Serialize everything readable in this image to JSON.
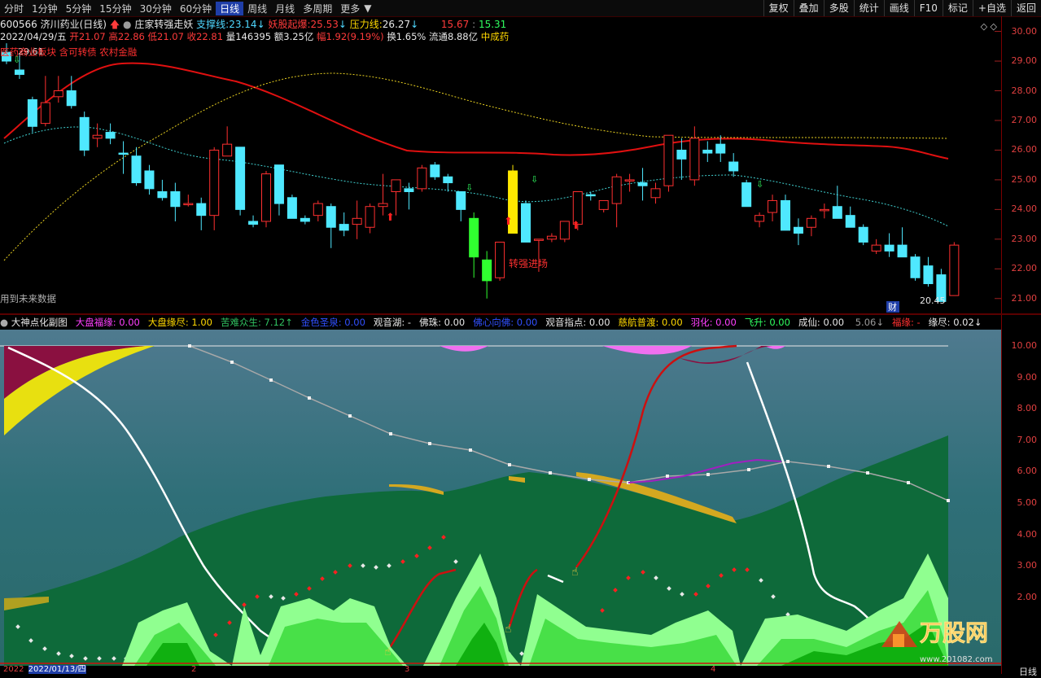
{
  "toolbar": {
    "periods": [
      "分时",
      "1分钟",
      "5分钟",
      "15分钟",
      "30分钟",
      "60分钟",
      "日线",
      "周线",
      "月线",
      "多周期",
      "更多"
    ],
    "active_period": "日线",
    "right_buttons": [
      "复权",
      "叠加",
      "多股",
      "统计",
      "画线",
      "F10",
      "标记",
      "+自选",
      "返回"
    ]
  },
  "stock": {
    "code_name": "600566 济川药业(日线)",
    "indicator_name": "庄家转强走妖",
    "support_label": "支撑线:",
    "support_value": "23.14",
    "bull_label": "妖股起爆:",
    "bull_value": "25.53",
    "pressure_label": "压力线:",
    "pressure_value": "26.27",
    "extra_red": "15.67",
    "extra_green": "15.31"
  },
  "quote": {
    "date": "2022/04/29/五",
    "open": "开21.07",
    "high": "高22.86",
    "low": "低21.07",
    "close": "收22.81",
    "volume": "量146395",
    "amount": "额3.25亿",
    "change": "幅1.92(9.19%)",
    "turnover": "换1.65%",
    "float": "流通8.88亿",
    "sector": "中成药"
  },
  "concepts": "医药商业板块 含可转债 农村金融",
  "price_marker": "29.61",
  "low_marker": "20.45",
  "text_annotation": "转强进场",
  "future_data_label": "用到未来数据",
  "finance_badge": "财",
  "main_y_labels": [
    "30.00",
    "29.00",
    "28.00",
    "27.00",
    "26.00",
    "25.00",
    "24.00",
    "23.00",
    "22.00",
    "21.00"
  ],
  "sub_y_labels": [
    "10.00",
    "9.00",
    "8.00",
    "7.00",
    "6.00",
    "5.00",
    "4.00",
    "3.00",
    "2.00"
  ],
  "sub_header": {
    "title": "大神点化副图",
    "items": [
      {
        "label": "大盘福缘:",
        "value": "0.00",
        "color": "#ff40ff"
      },
      {
        "label": "大盘缘尽:",
        "value": "1.00",
        "color": "#ffd800"
      },
      {
        "label": "苦难众生:",
        "value": "7.12↑",
        "color": "#30c060"
      },
      {
        "label": "金色圣泉:",
        "value": "0.00",
        "color": "#3050ff"
      },
      {
        "label": "观音湖:",
        "value": "-",
        "color": "#e8e8e8"
      },
      {
        "label": "佛珠:",
        "value": "0.00",
        "color": "#e8e8e8"
      },
      {
        "label": "佛心向佛:",
        "value": "0.00",
        "color": "#3050ff"
      },
      {
        "label": "观音指点:",
        "value": "0.00",
        "color": "#e8e8e8"
      },
      {
        "label": "慈航普渡:",
        "value": "0.00",
        "color": "#ffd800"
      },
      {
        "label": "羽化:",
        "value": "0.00",
        "color": "#ff40ff"
      },
      {
        "label": "飞升:",
        "value": "0.00",
        "color": "#30ff60"
      },
      {
        "label": "成仙:",
        "value": "0.00",
        "color": "#e8e8e8"
      },
      {
        "label": "",
        "value": "5.06↓",
        "color": "#9a9a9a"
      },
      {
        "label": "福缘:",
        "value": "-",
        "color": "#ff3030"
      },
      {
        "label": "缘尽:",
        "value": "0.02↓",
        "color": "#e8e8e8"
      }
    ]
  },
  "bottom": {
    "date_start": "2022/01/13/四",
    "year": "2022",
    "month_marks": [
      "2",
      "3",
      "4"
    ],
    "period_tag": "日线"
  },
  "logo": {
    "name": "万股网",
    "url": "www.201082.com"
  },
  "colors": {
    "up": "#ff3030",
    "down": "#4fe8ff",
    "limit_up": "#ffe800",
    "limit_down": "#30ff30",
    "ma_red": "#e01010",
    "accent_blue": "#1f3ea8"
  },
  "chart_data": {
    "type": "candlestick",
    "ylim": [
      20.5,
      30.4
    ],
    "candles": [
      [
        29.3,
        29.6,
        28.9,
        29.0,
        "d"
      ],
      [
        28.7,
        29.2,
        28.4,
        28.55,
        "d"
      ],
      [
        27.7,
        27.8,
        26.6,
        26.8,
        "d"
      ],
      [
        26.9,
        28.5,
        26.8,
        27.6,
        "u"
      ],
      [
        27.8,
        28.5,
        27.6,
        28.0,
        "u"
      ],
      [
        28.0,
        28.5,
        27.4,
        27.5,
        "d"
      ],
      [
        27.1,
        27.3,
        25.8,
        26.0,
        "d"
      ],
      [
        26.5,
        26.9,
        26.1,
        26.4,
        "u"
      ],
      [
        26.6,
        26.9,
        26.2,
        26.4,
        "d"
      ],
      [
        25.9,
        26.3,
        25.2,
        25.9,
        "d"
      ],
      [
        25.8,
        26.1,
        24.8,
        24.9,
        "d"
      ],
      [
        25.3,
        25.5,
        24.5,
        24.7,
        "d"
      ],
      [
        24.6,
        25.0,
        24.3,
        24.4,
        "d"
      ],
      [
        24.6,
        24.9,
        23.6,
        24.1,
        "d"
      ],
      [
        24.2,
        24.5,
        24.1,
        24.2,
        "u"
      ],
      [
        24.2,
        24.4,
        23.3,
        23.8,
        "d"
      ],
      [
        23.8,
        26.1,
        23.3,
        26.0,
        "u"
      ],
      [
        26.2,
        26.8,
        26.2,
        25.8,
        "u"
      ],
      [
        26.1,
        26.1,
        23.8,
        24.0,
        "d"
      ],
      [
        23.5,
        23.8,
        23.4,
        23.6,
        "d"
      ],
      [
        23.6,
        25.3,
        23.4,
        25.2,
        "u"
      ],
      [
        25.5,
        25.5,
        23.8,
        24.2,
        "d"
      ],
      [
        24.4,
        24.5,
        23.7,
        23.7,
        "d"
      ],
      [
        23.7,
        23.8,
        23.5,
        23.6,
        "d"
      ],
      [
        23.8,
        24.3,
        23.6,
        24.2,
        "u"
      ],
      [
        24.1,
        24.2,
        22.7,
        23.4,
        "d"
      ],
      [
        23.5,
        23.9,
        23.1,
        23.3,
        "d"
      ],
      [
        23.7,
        24.3,
        23.0,
        23.5,
        "u"
      ],
      [
        23.4,
        24.2,
        23.2,
        24.1,
        "u"
      ],
      [
        24.1,
        25.2,
        23.8,
        24.2,
        "u"
      ],
      [
        24.6,
        25.0,
        23.8,
        25.0,
        "u"
      ],
      [
        24.7,
        24.9,
        24.0,
        24.6,
        "d"
      ],
      [
        24.7,
        25.5,
        24.6,
        25.4,
        "u"
      ],
      [
        25.5,
        25.6,
        25.0,
        25.1,
        "d"
      ],
      [
        25.1,
        25.2,
        24.6,
        24.9,
        "d"
      ],
      [
        24.6,
        24.6,
        23.6,
        24.0,
        "d"
      ],
      [
        23.7,
        23.9,
        21.7,
        22.4,
        "d"
      ],
      [
        22.3,
        22.6,
        21.0,
        21.6,
        "d"
      ],
      [
        21.7,
        22.9,
        21.6,
        22.9,
        "u"
      ],
      [
        23.2,
        25.5,
        23.2,
        25.3,
        "u"
      ],
      [
        24.2,
        24.3,
        22.9,
        22.9,
        "d"
      ],
      [
        23.0,
        23.0,
        21.9,
        23.0,
        "u"
      ],
      [
        23.0,
        23.2,
        22.9,
        23.1,
        "u"
      ],
      [
        23.0,
        23.6,
        22.9,
        23.6,
        "u"
      ],
      [
        23.5,
        24.6,
        23.3,
        24.6,
        "u"
      ],
      [
        24.5,
        24.6,
        24.3,
        24.5,
        "d"
      ],
      [
        24.0,
        24.3,
        23.9,
        24.3,
        "u"
      ],
      [
        24.2,
        25.2,
        23.4,
        25.1,
        "u"
      ],
      [
        25.0,
        25.2,
        24.6,
        25.0,
        "u"
      ],
      [
        24.9,
        25.4,
        24.3,
        24.8,
        "d"
      ],
      [
        24.4,
        24.9,
        24.2,
        24.7,
        "u"
      ],
      [
        24.8,
        26.1,
        24.6,
        26.5,
        "u"
      ],
      [
        26.0,
        26.4,
        25.0,
        25.7,
        "d"
      ],
      [
        25.0,
        26.8,
        24.8,
        26.4,
        "u"
      ],
      [
        26.0,
        26.3,
        25.6,
        25.9,
        "d"
      ],
      [
        26.2,
        26.5,
        25.6,
        25.9,
        "d"
      ],
      [
        25.6,
        25.9,
        25.1,
        25.3,
        "d"
      ],
      [
        24.9,
        25.0,
        24.1,
        24.1,
        "d"
      ],
      [
        23.6,
        23.9,
        23.4,
        23.8,
        "u"
      ],
      [
        24.3,
        24.5,
        23.6,
        23.9,
        "u"
      ],
      [
        24.3,
        24.5,
        23.3,
        23.3,
        "d"
      ],
      [
        23.4,
        23.7,
        22.8,
        23.2,
        "d"
      ],
      [
        23.4,
        23.8,
        23.1,
        23.7,
        "u"
      ],
      [
        24.0,
        24.2,
        23.7,
        24.0,
        "u"
      ],
      [
        24.1,
        24.8,
        23.8,
        23.7,
        "d"
      ],
      [
        23.8,
        24.1,
        23.4,
        23.4,
        "d"
      ],
      [
        23.4,
        23.5,
        22.8,
        22.9,
        "d"
      ],
      [
        22.8,
        23.0,
        22.5,
        22.6,
        "u"
      ],
      [
        22.8,
        23.2,
        22.4,
        22.6,
        "d"
      ],
      [
        22.8,
        23.4,
        22.5,
        22.4,
        "d"
      ],
      [
        22.4,
        22.5,
        21.6,
        21.7,
        "d"
      ],
      [
        22.1,
        22.4,
        21.4,
        21.5,
        "d"
      ],
      [
        21.8,
        22.0,
        20.9,
        20.9,
        "d"
      ],
      [
        21.1,
        22.9,
        21.1,
        22.8,
        "u"
      ]
    ],
    "limit_up_index": 39,
    "limit_down_indices": [
      37,
      36
    ]
  }
}
